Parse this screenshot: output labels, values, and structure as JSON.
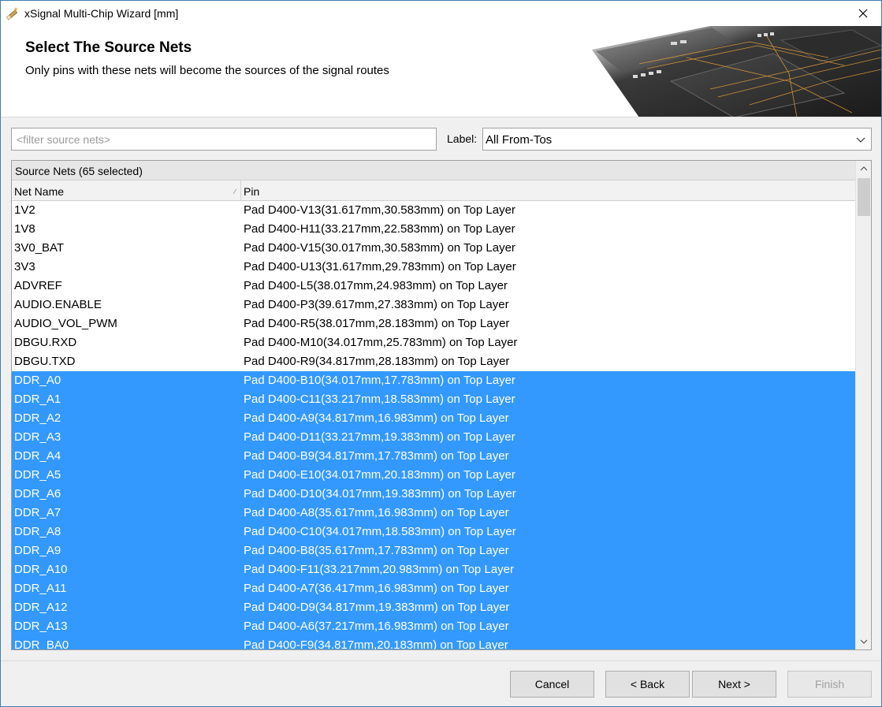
{
  "window": {
    "title": "xSignal Multi-Chip Wizard [mm]",
    "icon": "wizard-wand-icon",
    "close_icon": "close-icon"
  },
  "header": {
    "title": "Select The Source Nets",
    "subtitle": "Only pins with these nets will become the sources of the signal routes"
  },
  "filter": {
    "placeholder": "<filter source nets>",
    "value": ""
  },
  "label_selector": {
    "label": "Label:",
    "selected": "All From-Tos"
  },
  "grid": {
    "group_header": "Source Nets (65 selected)",
    "columns": [
      "Net Name",
      "Pin"
    ],
    "rows": [
      {
        "net": "1V2",
        "pin": "Pad D400-V13(31.617mm,30.583mm) on Top Layer",
        "selected": false
      },
      {
        "net": "1V8",
        "pin": "Pad D400-H11(33.217mm,22.583mm) on Top Layer",
        "selected": false
      },
      {
        "net": "3V0_BAT",
        "pin": "Pad D400-V15(30.017mm,30.583mm) on Top Layer",
        "selected": false
      },
      {
        "net": "3V3",
        "pin": "Pad D400-U13(31.617mm,29.783mm) on Top Layer",
        "selected": false
      },
      {
        "net": "ADVREF",
        "pin": "Pad D400-L5(38.017mm,24.983mm) on Top Layer",
        "selected": false
      },
      {
        "net": "AUDIO.ENABLE",
        "pin": "Pad D400-P3(39.617mm,27.383mm) on Top Layer",
        "selected": false
      },
      {
        "net": "AUDIO_VOL_PWM",
        "pin": "Pad D400-R5(38.017mm,28.183mm) on Top Layer",
        "selected": false
      },
      {
        "net": "DBGU.RXD",
        "pin": "Pad D400-M10(34.017mm,25.783mm) on Top Layer",
        "selected": false
      },
      {
        "net": "DBGU.TXD",
        "pin": "Pad D400-R9(34.817mm,28.183mm) on Top Layer",
        "selected": false
      },
      {
        "net": "DDR_A0",
        "pin": "Pad D400-B10(34.017mm,17.783mm) on Top Layer",
        "selected": true
      },
      {
        "net": "DDR_A1",
        "pin": "Pad D400-C11(33.217mm,18.583mm) on Top Layer",
        "selected": true
      },
      {
        "net": "DDR_A2",
        "pin": "Pad D400-A9(34.817mm,16.983mm) on Top Layer",
        "selected": true
      },
      {
        "net": "DDR_A3",
        "pin": "Pad D400-D11(33.217mm,19.383mm) on Top Layer",
        "selected": true
      },
      {
        "net": "DDR_A4",
        "pin": "Pad D400-B9(34.817mm,17.783mm) on Top Layer",
        "selected": true
      },
      {
        "net": "DDR_A5",
        "pin": "Pad D400-E10(34.017mm,20.183mm) on Top Layer",
        "selected": true
      },
      {
        "net": "DDR_A6",
        "pin": "Pad D400-D10(34.017mm,19.383mm) on Top Layer",
        "selected": true
      },
      {
        "net": "DDR_A7",
        "pin": "Pad D400-A8(35.617mm,16.983mm) on Top Layer",
        "selected": true
      },
      {
        "net": "DDR_A8",
        "pin": "Pad D400-C10(34.017mm,18.583mm) on Top Layer",
        "selected": true
      },
      {
        "net": "DDR_A9",
        "pin": "Pad D400-B8(35.617mm,17.783mm) on Top Layer",
        "selected": true
      },
      {
        "net": "DDR_A10",
        "pin": "Pad D400-F11(33.217mm,20.983mm) on Top Layer",
        "selected": true
      },
      {
        "net": "DDR_A11",
        "pin": "Pad D400-A7(36.417mm,16.983mm) on Top Layer",
        "selected": true
      },
      {
        "net": "DDR_A12",
        "pin": "Pad D400-D9(34.817mm,19.383mm) on Top Layer",
        "selected": true
      },
      {
        "net": "DDR_A13",
        "pin": "Pad D400-A6(37.217mm,16.983mm) on Top Layer",
        "selected": true
      },
      {
        "net": "DDR_BA0",
        "pin": "Pad D400-F9(34.817mm,20.183mm) on Top Layer",
        "selected": true
      }
    ]
  },
  "buttons": {
    "cancel": "Cancel",
    "back": "< Back",
    "next": "Next >",
    "finish": "Finish"
  },
  "colors": {
    "selection": "#3399ff",
    "titlebar_border": "#3c7fb1"
  }
}
